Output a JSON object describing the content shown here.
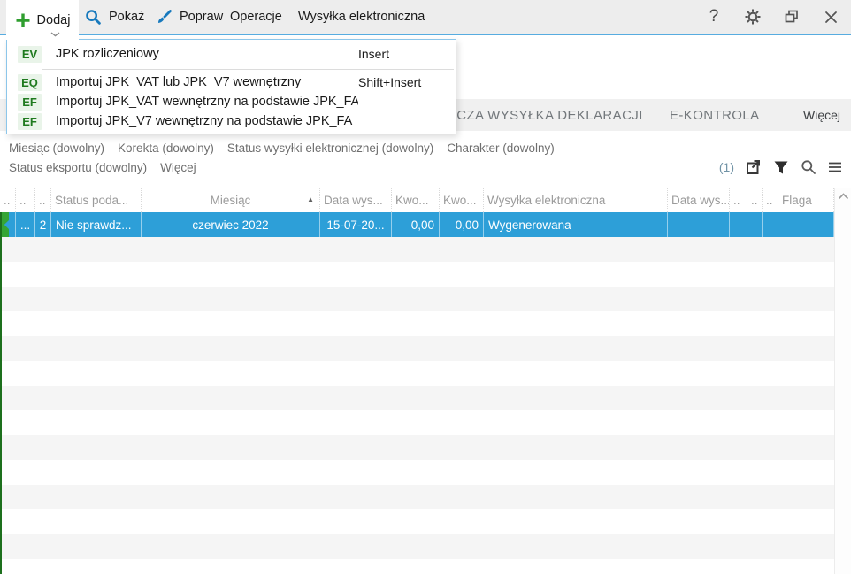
{
  "toolbar": {
    "items": [
      {
        "label": "Dodaj"
      },
      {
        "label": "Pokaż"
      },
      {
        "label": "Popraw"
      },
      {
        "label": "Operacje"
      },
      {
        "label": "Wysyłka elektroniczna"
      }
    ],
    "help_label": "?"
  },
  "menu": {
    "items": [
      {
        "badge": "EV",
        "label": "JPK rozliczeniowy",
        "shortcut": "Insert"
      },
      {
        "badge": "EQ",
        "label": "Importuj JPK_VAT lub JPK_V7 wewnętrzny",
        "shortcut": "Shift+Insert"
      },
      {
        "badge": "EF",
        "label": "Importuj JPK_VAT wewnętrzny na podstawie JPK_FA",
        "shortcut": ""
      },
      {
        "badge": "EF",
        "label": "Importuj JPK_V7 wewnętrzny na podstawie JPK_FA",
        "shortcut": ""
      }
    ]
  },
  "tabs": {
    "visible": [
      {
        "label": "RCZA WYSYŁKA DEKLARACJI"
      },
      {
        "label": "E-KONTROLA"
      }
    ],
    "more_label": "Więcej"
  },
  "filters": {
    "row1": [
      "Miesiąc (dowolny)",
      "Korekta (dowolny)",
      "Status wysyłki elektronicznej (dowolny)",
      "Charakter (dowolny)"
    ],
    "row2": [
      "Status eksportu (dowolny)",
      "Więcej"
    ],
    "count": "(1)"
  },
  "table": {
    "columns": [
      "..",
      "..",
      "..",
      "Status poda...",
      "Miesiąc",
      "Data wys...",
      "Kwo...",
      "Kwo...",
      "Wysyłka elektroniczna",
      "Data wys...",
      "..",
      "..",
      "..",
      "Flaga"
    ],
    "sort_column": "Miesiąc",
    "sort_direction": "asc",
    "rows": [
      {
        "cells": [
          "",
          "...",
          "2",
          "Nie sprawdz...",
          "czerwiec 2022",
          "15-07-20...",
          "0,00",
          "0,00",
          "Wygenerowana",
          "",
          "",
          "",
          "",
          ""
        ]
      }
    ]
  },
  "colors": {
    "selection_blue": "#2d9fd8",
    "toolbar_accent_line": "#57ace0",
    "marker_green": "#35a535",
    "badge_green_bg": "#e9f4e9",
    "badge_green_text": "#1f7a1f",
    "stripe_gray": "#f5f5f5"
  }
}
